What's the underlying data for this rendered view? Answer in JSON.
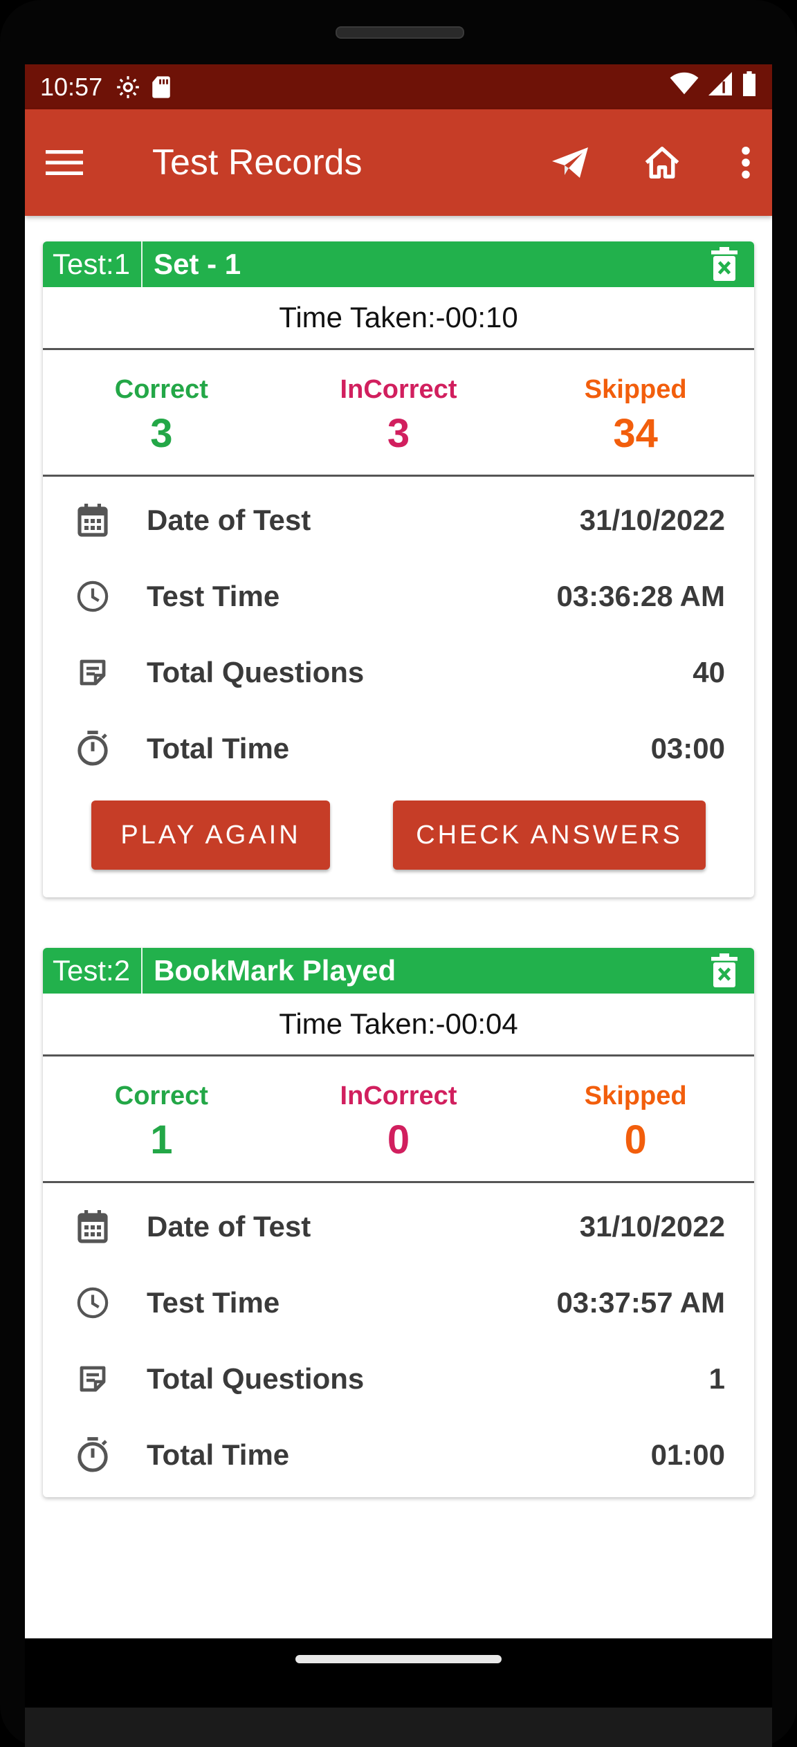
{
  "status_bar": {
    "time": "10:57"
  },
  "app_bar": {
    "title": "Test Records",
    "icons": [
      "menu-icon",
      "send-icon",
      "home-icon",
      "more-vert-icon"
    ]
  },
  "colors": {
    "app_bar": "#c63d27",
    "status_bar": "#6e1207",
    "card_header": "#22b14c",
    "correct": "#23a747",
    "incorrect": "#d11f5e",
    "skipped": "#f25e0c"
  },
  "labels": {
    "correct": "Correct",
    "incorrect": "InCorrect",
    "skipped": "Skipped",
    "date_of_test": "Date of Test",
    "test_time": "Test Time",
    "total_questions": "Total Questions",
    "total_time": "Total Time"
  },
  "records": [
    {
      "test_no": "Test:1",
      "name": "Set - 1",
      "time_taken": "Time Taken:-00:10",
      "correct": "3",
      "incorrect": "3",
      "skipped": "34",
      "date_of_test": "31/10/2022",
      "test_time": "03:36:28 AM",
      "total_questions": "40",
      "total_time": "03:00",
      "play_again_label": "PLAY AGAIN",
      "check_answers_label": "CHECK ANSWERS"
    },
    {
      "test_no": "Test:2",
      "name": "BookMark Played",
      "time_taken": "Time Taken:-00:04",
      "correct": "1",
      "incorrect": "0",
      "skipped": "0",
      "date_of_test": "31/10/2022",
      "test_time": "03:37:57 AM",
      "total_questions": "1",
      "total_time": "01:00"
    }
  ]
}
